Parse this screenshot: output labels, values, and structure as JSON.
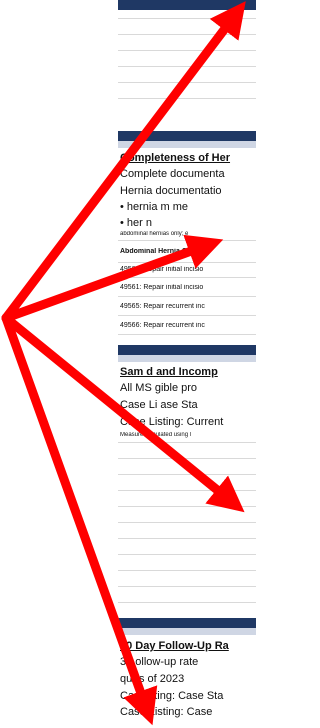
{
  "sections": {
    "hernia": {
      "title": "Completeness of Her",
      "lines": [
        "Complete documenta",
        "Hernia documentatio",
        "• hernia m   me",
        "• her      n"
      ],
      "note": "abdominal hernias only; e",
      "cpt_header": "Abdominal Hernia CPT Co",
      "cpt_rows": [
        "49560: Repair initial incisio",
        "49561: Repair initial incisio",
        "49565: Repair recurrent inc",
        "49566: Repair recurrent inc"
      ]
    },
    "sampled": {
      "title": "Sam    d and Incomp",
      "lines": [
        "All MS      gible pro",
        "Case Li     ase Sta",
        "Case Listing: Current"
      ],
      "note": "Measure calculated using l"
    },
    "followup": {
      "title": "30 Day Follow-Up Ra",
      "lines": [
        "30    ollow-up rate",
        "qu    rs of 2023",
        "Case    sting: Case Sta",
        "Case Listing: Case"
      ]
    }
  },
  "colors": {
    "arrow": "#ff0000",
    "header_bar": "#1f3864",
    "strip": "#cfd6e4"
  },
  "icons": [
    "arrow-icon"
  ]
}
